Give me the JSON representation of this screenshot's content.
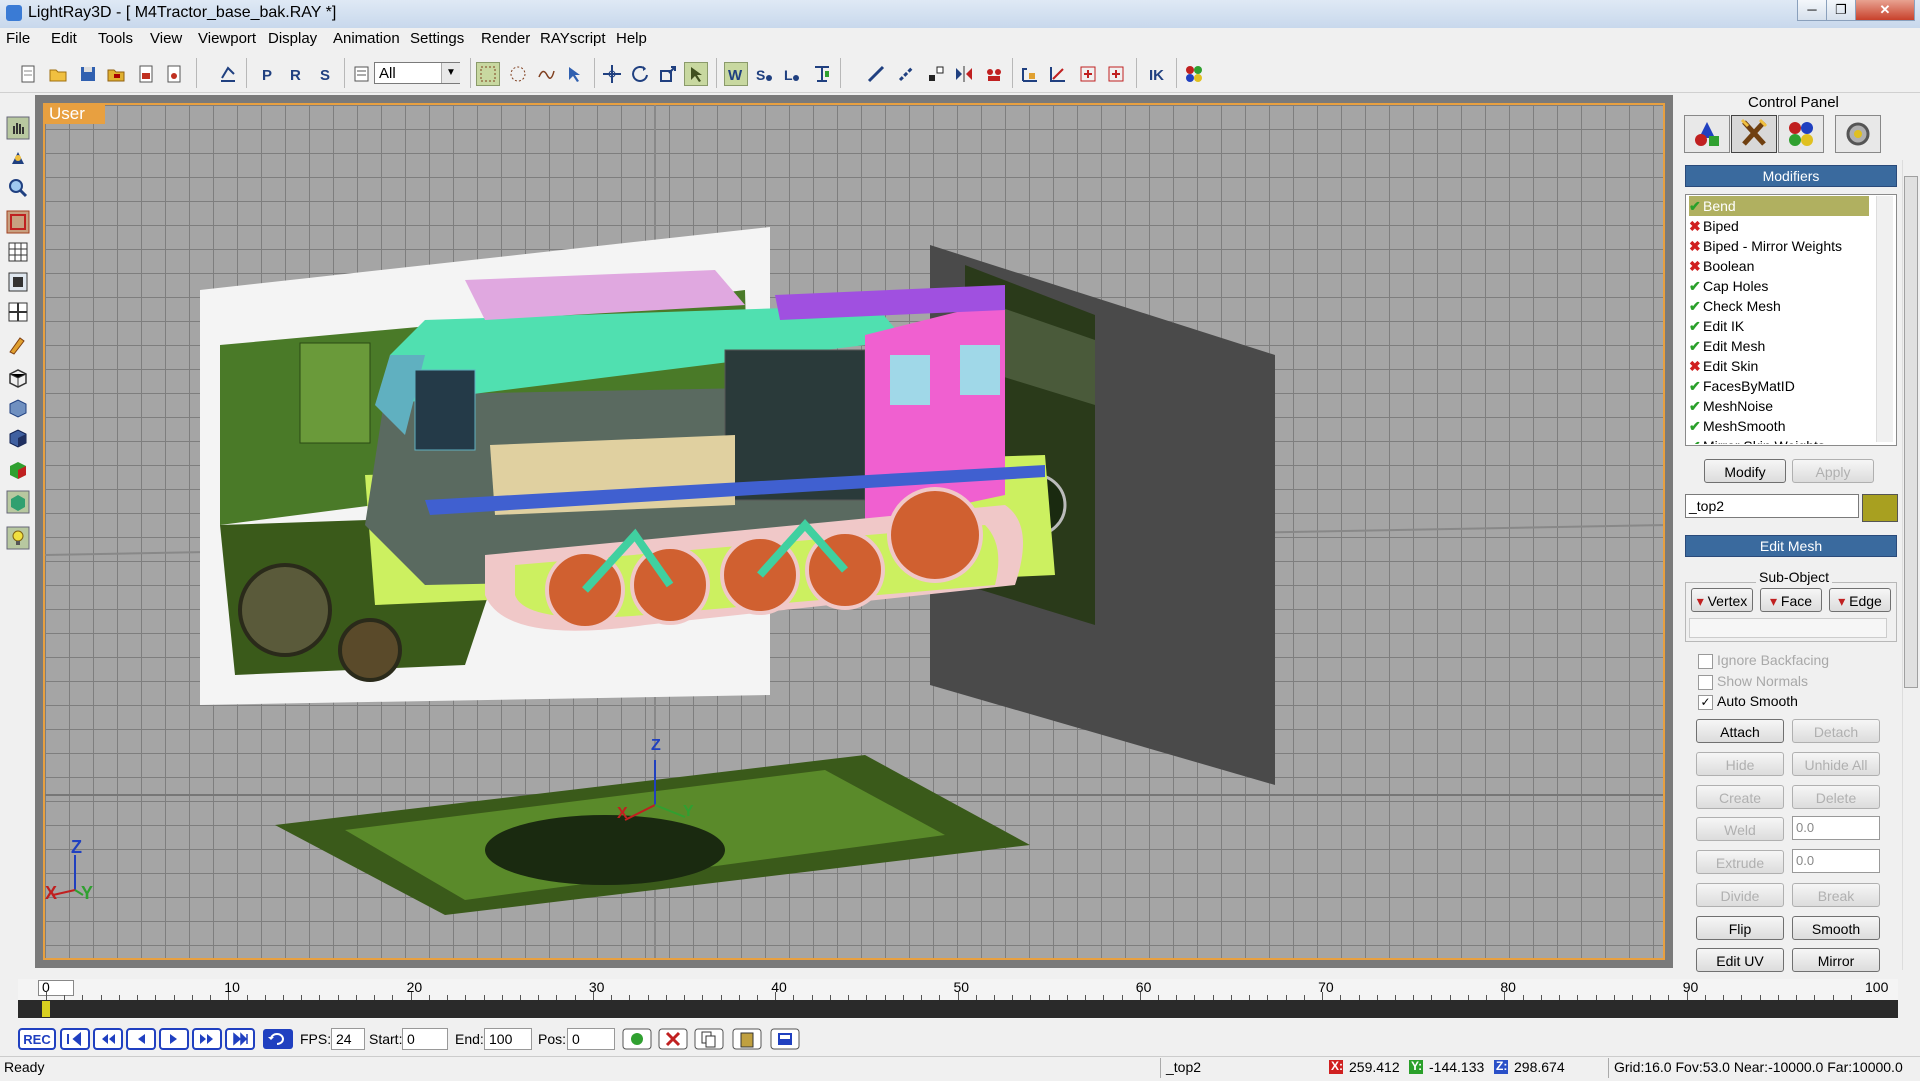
{
  "window": {
    "title": "LightRay3D - [ M4Tractor_base_bak.RAY *]",
    "buttons": {
      "minimize": "─",
      "maximize": "❐",
      "close": "✕"
    }
  },
  "menu": [
    "File",
    "Edit",
    "Tools",
    "View",
    "Viewport",
    "Display",
    "Animation",
    "Settings",
    "Render",
    "RAYscript",
    "Help"
  ],
  "toolbar": {
    "selection_filter": "All",
    "icons": [
      "new-file",
      "open-folder",
      "save",
      "open-archive",
      "merge",
      "export",
      "undo",
      "path-p",
      "path-r",
      "path-s",
      "select-list",
      "select-region",
      "select-circle",
      "select-lasso",
      "select-arrow",
      "move",
      "rotate",
      "scale",
      "link",
      "world-coords",
      "local-coords",
      "parent-coords",
      "align-tool",
      "tape-measure",
      "link-tool",
      "unlink-tool",
      "mirror",
      "array",
      "snap-angle",
      "snap-grid",
      "snap-plus",
      "snap-point",
      "ik-tool",
      "material-editor"
    ]
  },
  "left_tools": [
    "pan-hand",
    "orbit",
    "zoom",
    "zoom-region",
    "grid",
    "render-region",
    "layout",
    "paint",
    "cube-outline",
    "cube-solid",
    "cube-shaded",
    "cube-color",
    "cube-textured",
    "light-bulb"
  ],
  "viewport": {
    "label": "User",
    "axis_z": "Z",
    "axis_x": "X",
    "axis_y": "Y"
  },
  "control_panel": {
    "title": "Control Panel",
    "tabs": [
      "create-shapes",
      "modify-tools",
      "display-colors",
      "utilities"
    ],
    "modifiers_header": "Modifiers",
    "modifiers": [
      {
        "label": "Bend",
        "enabled": true,
        "selected": true
      },
      {
        "label": "Biped",
        "enabled": false
      },
      {
        "label": "Biped - Mirror Weights",
        "enabled": false
      },
      {
        "label": "Boolean",
        "enabled": false
      },
      {
        "label": "Cap Holes",
        "enabled": true
      },
      {
        "label": "Check Mesh",
        "enabled": true
      },
      {
        "label": "Edit IK",
        "enabled": true
      },
      {
        "label": "Edit Mesh",
        "enabled": true
      },
      {
        "label": "Edit Skin",
        "enabled": false
      },
      {
        "label": "FacesByMatID",
        "enabled": true
      },
      {
        "label": "MeshNoise",
        "enabled": true
      },
      {
        "label": "MeshSmooth",
        "enabled": true
      },
      {
        "label": "Mirror Skin Weights",
        "enabled": true
      }
    ],
    "modify_label": "Modify",
    "apply_label": "Apply",
    "object_name": "_top2",
    "object_color": "#a8a020",
    "edit_mesh_header": "Edit Mesh",
    "subobject_label": "Sub-Object",
    "subobjects": [
      "Vertex",
      "Face",
      "Edge"
    ],
    "checkboxes": [
      {
        "label": "Ignore Backfacing",
        "checked": false,
        "enabled": false
      },
      {
        "label": "Show Normals",
        "checked": false,
        "enabled": false
      },
      {
        "label": "Auto Smooth",
        "checked": true,
        "enabled": true
      }
    ],
    "buttons": {
      "attach": "Attach",
      "detach": "Detach",
      "hide": "Hide",
      "unhide_all": "Unhide All",
      "create": "Create",
      "delete": "Delete",
      "weld": "Weld",
      "weld_value": "0.0",
      "extrude": "Extrude",
      "extrude_value": "0.0",
      "divide": "Divide",
      "break": "Break",
      "flip": "Flip",
      "smooth": "Smooth",
      "edit_uv": "Edit UV",
      "mirror": "Mirror"
    }
  },
  "timeline": {
    "ticks": [
      "0",
      "10",
      "20",
      "30",
      "40",
      "50",
      "60",
      "70",
      "80",
      "90",
      "100"
    ],
    "current_frame": 0
  },
  "playback": {
    "rec": "REC",
    "fps_label": "FPS:",
    "fps": "24",
    "start_label": "Start:",
    "start": "0",
    "end_label": "End:",
    "end": "100",
    "pos_label": "Pos:",
    "pos": "0"
  },
  "status": {
    "text": "Ready",
    "object": "_top2",
    "x_label": "X:",
    "x": "259.412",
    "y_label": "Y:",
    "y": "-144.133",
    "z_label": "Z:",
    "z": "298.674",
    "info": "Grid:16.0 Fov:53.0 Near:-10000.0 Far:10000.0"
  },
  "colors": {
    "accent": "#e8a040",
    "header": "#3a6a9e",
    "status_x": "#d02020",
    "status_y": "#2aa02a",
    "status_z": "#2a50c8"
  }
}
